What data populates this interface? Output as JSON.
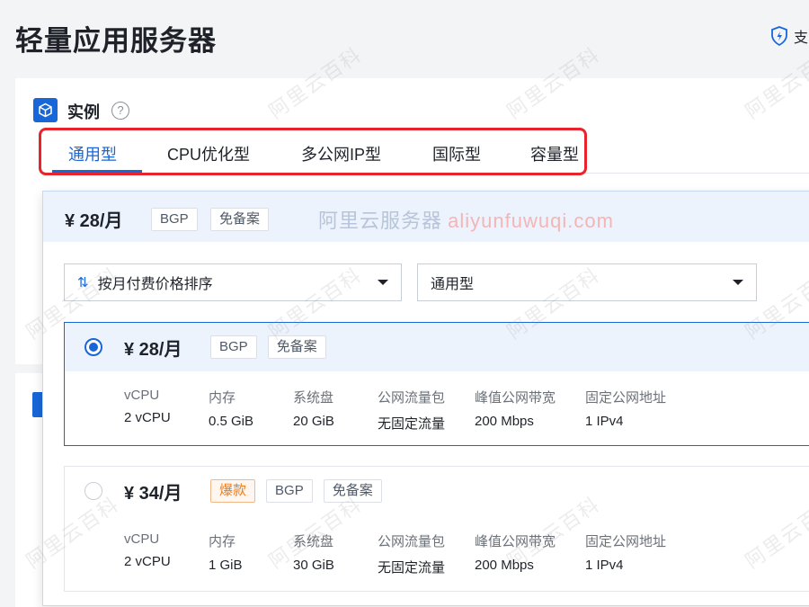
{
  "page": {
    "title": "轻量应用服务器",
    "support_label": "支"
  },
  "section": {
    "title": "实例",
    "help_symbol": "?"
  },
  "tabs": [
    {
      "label": "通用型",
      "active": true
    },
    {
      "label": "CPU优化型"
    },
    {
      "label": "多公网IP型"
    },
    {
      "label": "国际型"
    },
    {
      "label": "容量型"
    }
  ],
  "selected_summary": {
    "price": "¥ 28/月",
    "tags": [
      "BGP",
      "免备案"
    ]
  },
  "watermark": {
    "text_cn": "阿里云服务器",
    "text_en": "aliyunfuwuqi.com",
    "repeat": "阿里云百科"
  },
  "filters": {
    "sort": {
      "value": "按月付费价格排序",
      "icon": "sort-arrows-icon"
    },
    "type": {
      "value": "通用型"
    }
  },
  "spec_labels": [
    "vCPU",
    "内存",
    "系统盘",
    "公网流量包",
    "峰值公网带宽",
    "固定公网地址"
  ],
  "plans": [
    {
      "price": "¥ 28/月",
      "selected": true,
      "tags": [
        "BGP",
        "免备案"
      ],
      "specs": [
        "2 vCPU",
        "0.5 GiB",
        "20 GiB",
        "无固定流量",
        "200 Mbps",
        "1 IPv4"
      ]
    },
    {
      "price": "¥ 34/月",
      "selected": false,
      "hot_tag": "爆款",
      "tags": [
        "BGP",
        "免备案"
      ],
      "specs": [
        "2 vCPU",
        "1 GiB",
        "30 GiB",
        "无固定流量",
        "200 Mbps",
        "1 IPv4"
      ]
    }
  ],
  "colors": {
    "accent": "#1966d8",
    "highlight_border": "#e8232b",
    "hot": "#f07914"
  }
}
